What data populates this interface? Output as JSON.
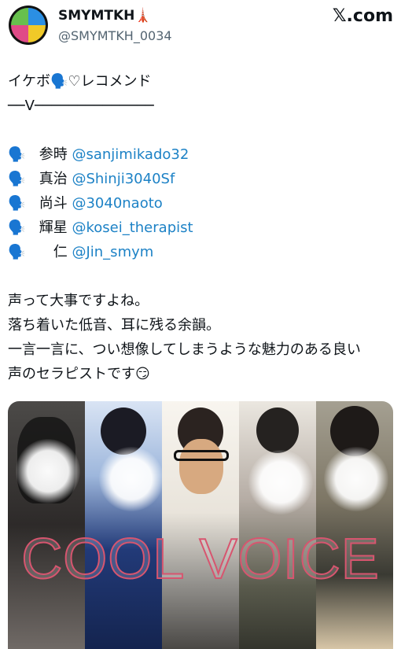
{
  "header": {
    "name": "SMYMTKH🗼",
    "handle": "@SMYMTKH_0034",
    "x_logo": "𝕏.com"
  },
  "tweet": {
    "title_line": "イケボ🗣️♡レコメンド",
    "under_line": "──V──────────────",
    "recommendations": [
      {
        "icon": "🗣️",
        "name": "参時",
        "link": "@sanjimikado32"
      },
      {
        "icon": "🗣️",
        "name": "真治",
        "link": "@Shinji3040Sf"
      },
      {
        "icon": "🗣️",
        "name": "尚斗",
        "link": "@3040naoto"
      },
      {
        "icon": "🗣️",
        "name": "輝星",
        "link": "@kosei_therapist"
      },
      {
        "icon": "🗣️",
        "name": "　仁",
        "link": "@Jin_smym"
      }
    ],
    "body_lines": [
      "声って大事ですよね。",
      "落ち着いた低音、耳に残る余韻。",
      "一言一言に、つい想像してしまうような魅力のある良い",
      "声のセラピストです😏"
    ]
  },
  "image": {
    "banner_text": "COOL VOICE"
  },
  "colors": {
    "link": "#1d82c6",
    "banner": "#d7556f"
  }
}
